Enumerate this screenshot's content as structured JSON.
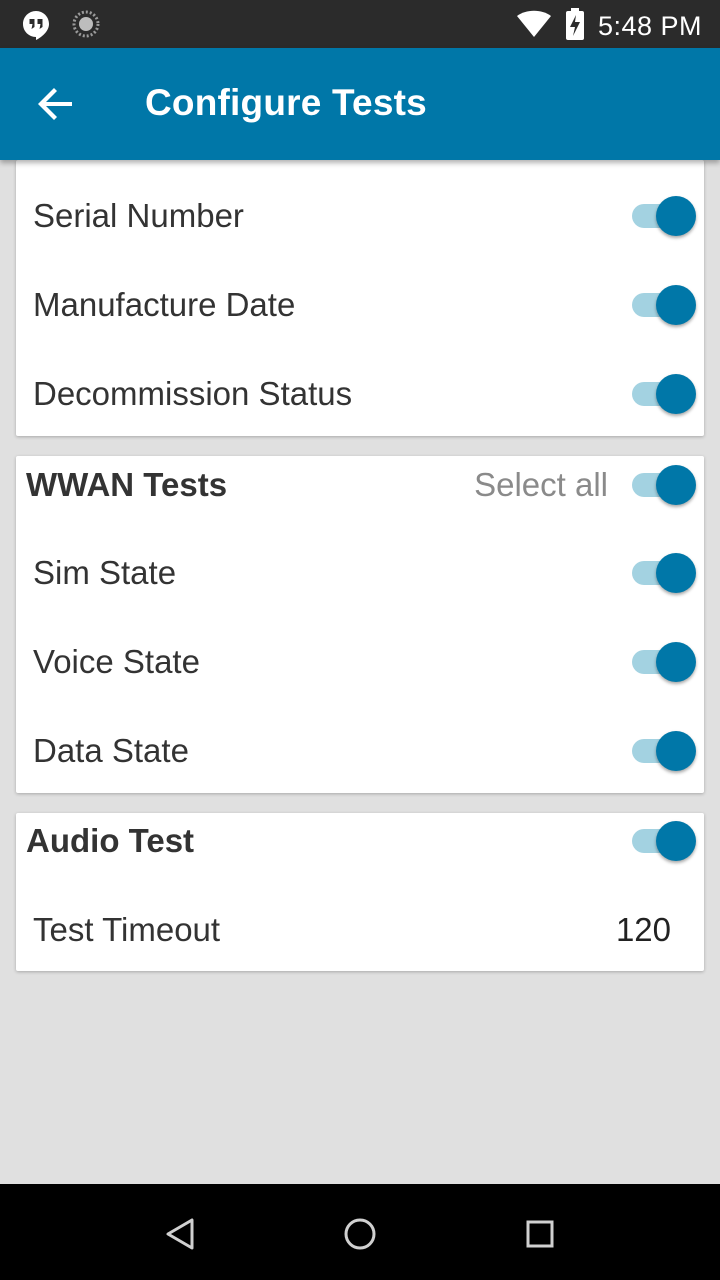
{
  "status_bar": {
    "time": "5:48 PM",
    "icons": [
      "hangouts-icon",
      "loading-icon",
      "wifi-icon",
      "battery-charging-icon"
    ]
  },
  "app_bar": {
    "title": "Configure Tests",
    "back_icon": "arrow-left-icon"
  },
  "device_card": {
    "items": [
      {
        "label": "Serial Number",
        "enabled": true
      },
      {
        "label": "Manufacture Date",
        "enabled": true
      },
      {
        "label": "Decommission Status",
        "enabled": true
      }
    ]
  },
  "wwan_card": {
    "title": "WWAN Tests",
    "select_all_label": "Select all",
    "select_all_enabled": true,
    "items": [
      {
        "label": "Sim State",
        "enabled": true
      },
      {
        "label": "Voice State",
        "enabled": true
      },
      {
        "label": "Data State",
        "enabled": true
      }
    ]
  },
  "audio_card": {
    "title": "Audio Test",
    "enabled": true,
    "timeout_label": "Test Timeout",
    "timeout_value": "120"
  },
  "colors": {
    "accent": "#0077a8",
    "toggle_track": "#a3d2e1",
    "background": "#e0e0e0"
  },
  "nav_bar": {
    "icons": [
      "back-triangle-icon",
      "home-circle-icon",
      "recents-square-icon"
    ]
  }
}
